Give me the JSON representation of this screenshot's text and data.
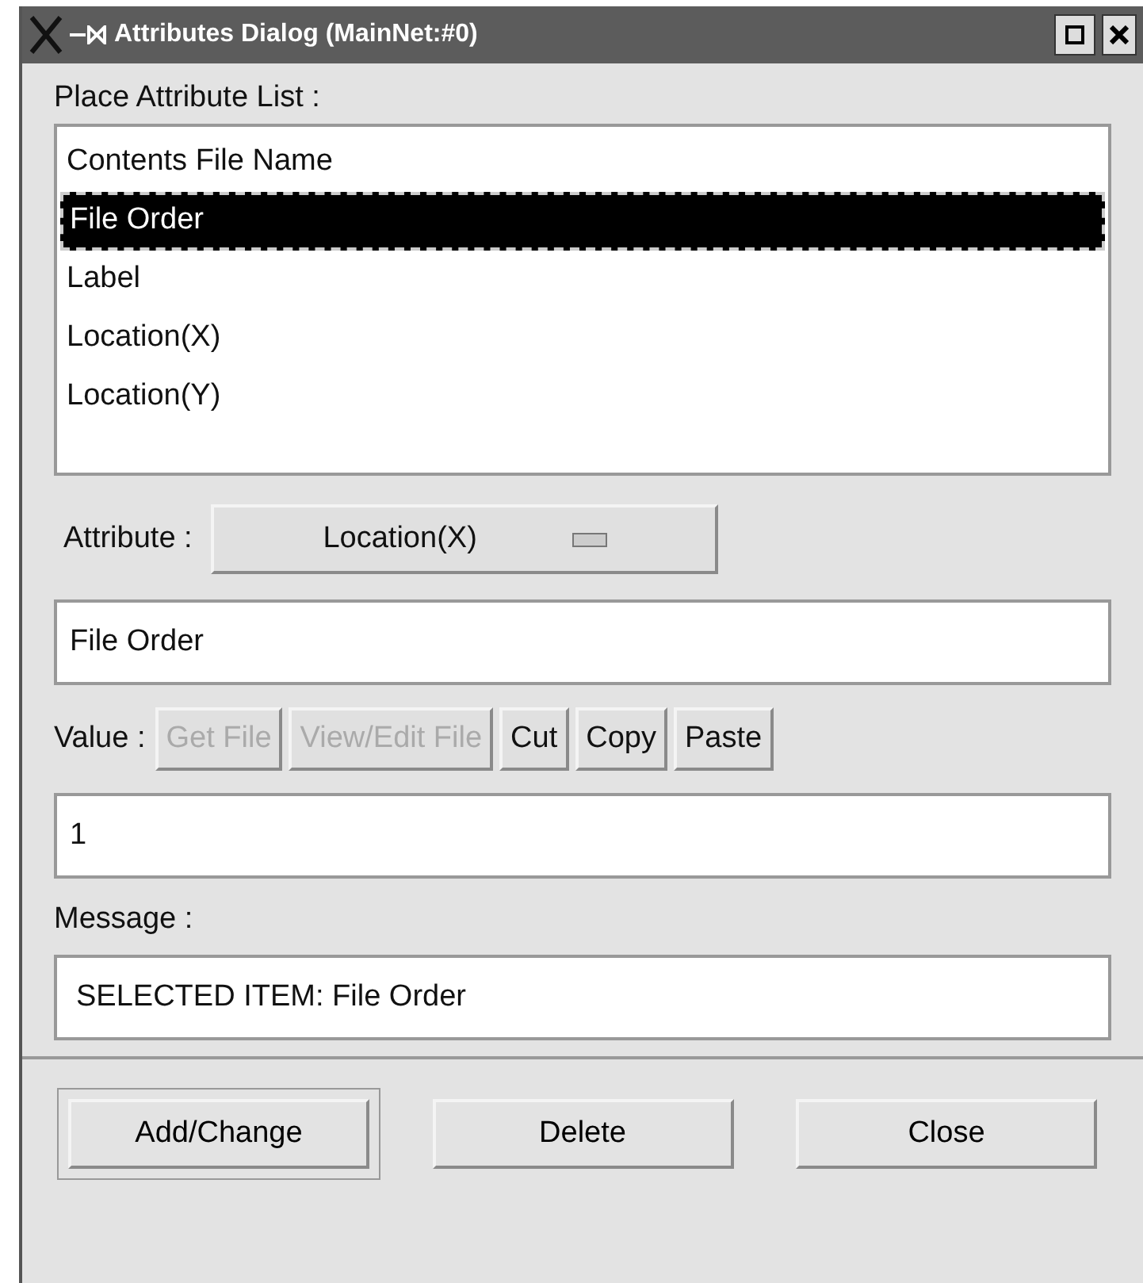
{
  "window": {
    "title": "Attributes Dialog (MainNet:#0)"
  },
  "list_label": "Place Attribute List :",
  "list_items": [
    {
      "label": "Contents File Name",
      "selected": false
    },
    {
      "label": "File Order",
      "selected": true
    },
    {
      "label": "Label",
      "selected": false
    },
    {
      "label": "Location(X)",
      "selected": false
    },
    {
      "label": "Location(Y)",
      "selected": false
    }
  ],
  "attribute": {
    "label": "Attribute :",
    "value": "Location(X)"
  },
  "name_field": {
    "value": "File Order"
  },
  "value_label": "Value :",
  "value_buttons": [
    {
      "label": "Get File",
      "disabled": true
    },
    {
      "label": "View/Edit File",
      "disabled": true
    },
    {
      "label": "Cut",
      "disabled": false
    },
    {
      "label": "Copy",
      "disabled": false
    },
    {
      "label": "Paste",
      "disabled": false
    }
  ],
  "value_field": {
    "value": "1"
  },
  "message_label": "Message :",
  "message_field": {
    "value": "SELECTED ITEM: File Order"
  },
  "buttons": [
    {
      "label": "Add/Change",
      "default": true
    },
    {
      "label": "Delete",
      "default": false
    },
    {
      "label": "Close",
      "default": false
    }
  ]
}
